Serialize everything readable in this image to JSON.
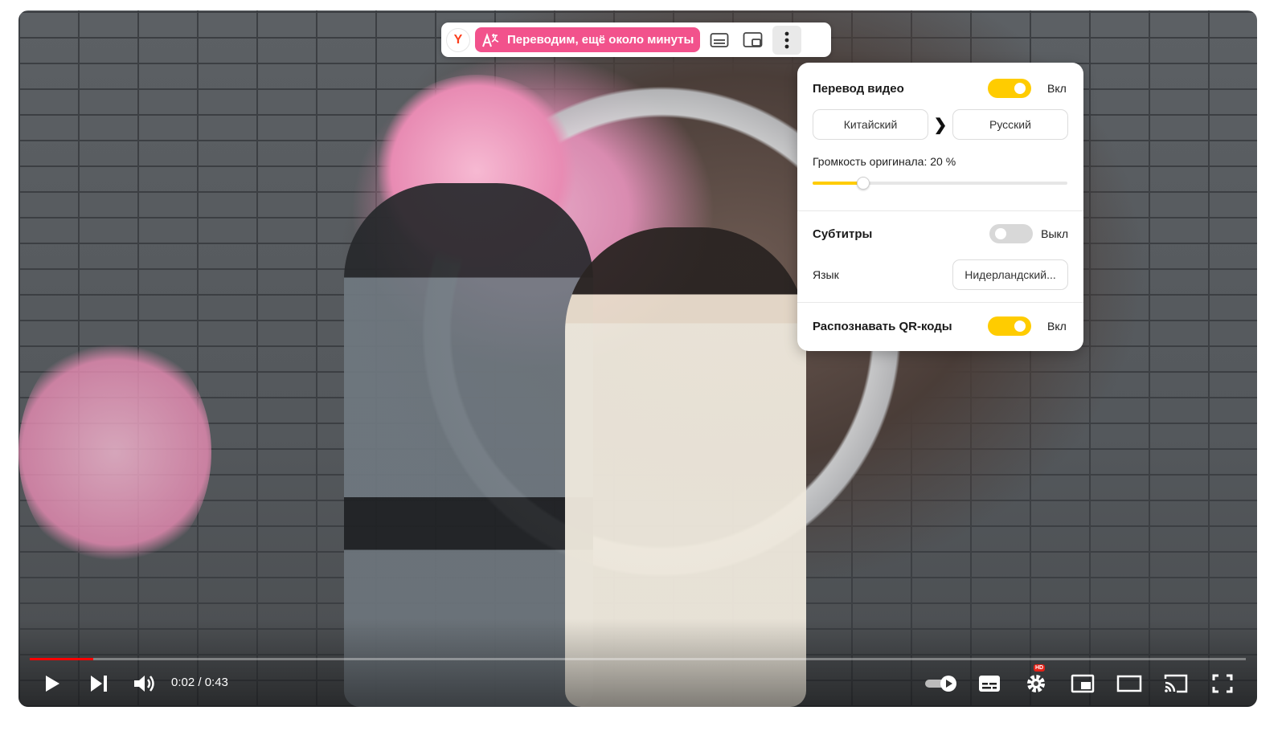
{
  "toolbar": {
    "logo": "Y",
    "translate_status": "Переводим, ещё около минуты",
    "icons": [
      "yandex-logo",
      "translate-icon",
      "subtitles-icon",
      "pip-icon",
      "more-vert-icon"
    ]
  },
  "panel": {
    "video_translation": {
      "label": "Перевод видео",
      "state": "Вкл",
      "enabled": true
    },
    "languages": {
      "from": "Китайский",
      "to": "Русский",
      "arrow": "❯"
    },
    "original_volume": {
      "label": "Громкость оригинала: 20 %",
      "value": 0.2
    },
    "subtitles": {
      "label": "Субтитры",
      "state": "Выкл",
      "enabled": false
    },
    "subtitle_language": {
      "label": "Язык",
      "value": "Нидерландский..."
    },
    "qr_codes": {
      "label": "Распознавать QR-коды",
      "state": "Вкл",
      "enabled": true
    }
  },
  "player": {
    "time": "0:02 / 0:43",
    "progress_fraction": 0.052,
    "hd_badge": "HD",
    "accent_color": "#ff0000",
    "toggle_color": "#ffcc00"
  }
}
